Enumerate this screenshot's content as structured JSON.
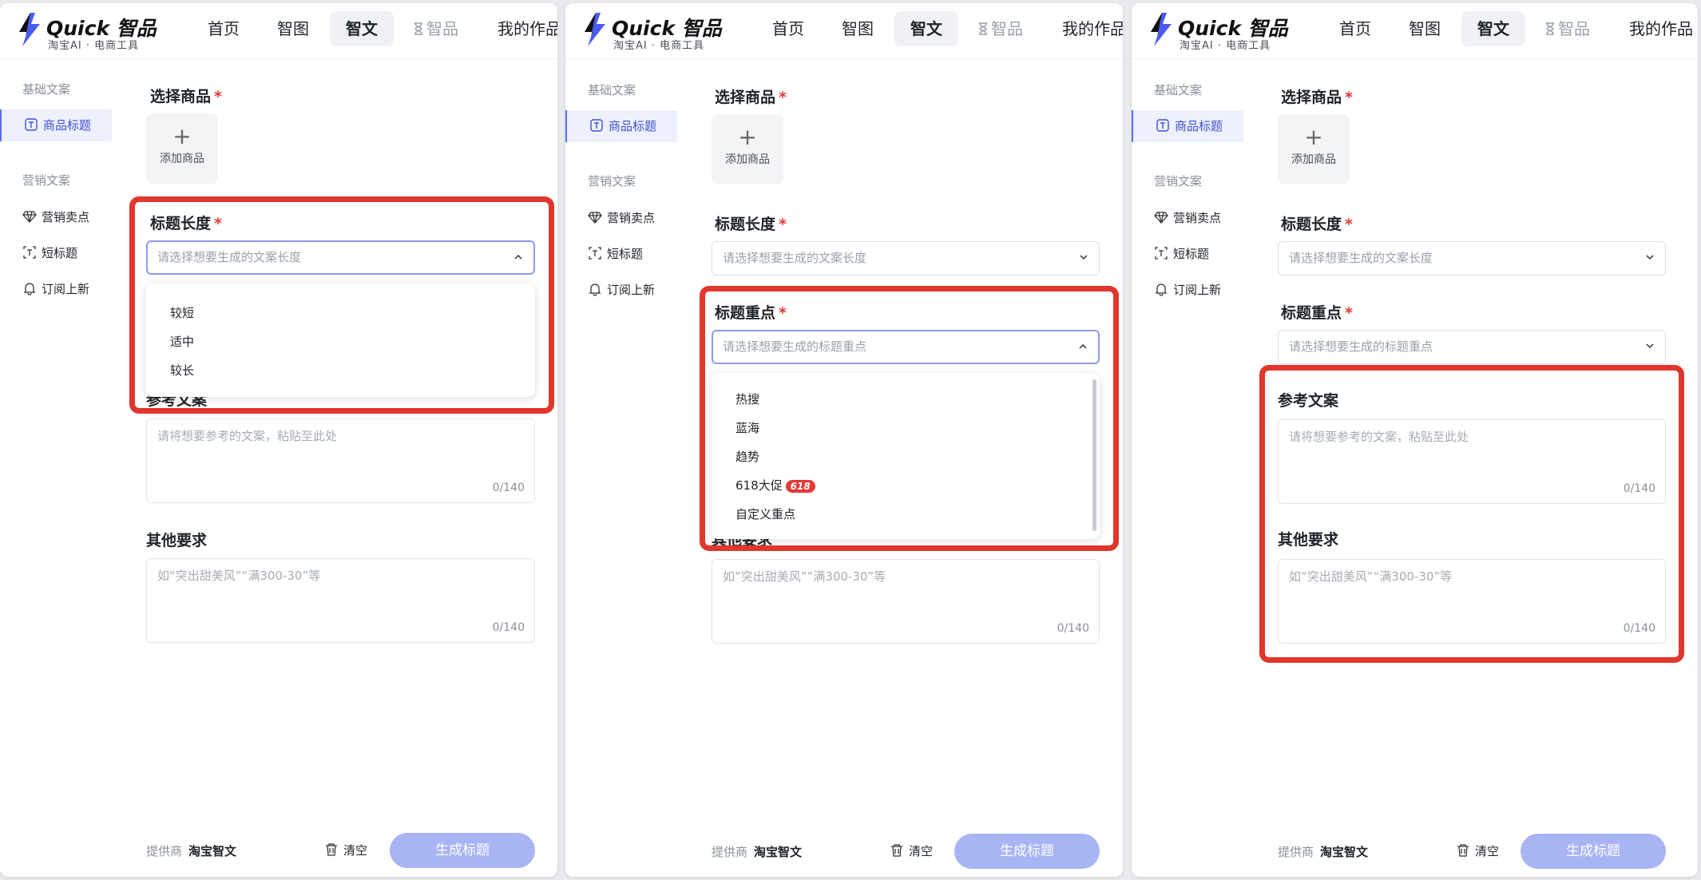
{
  "logo": {
    "brand": "Quick 智品",
    "tagline": "淘宝AI · 电商工具"
  },
  "nav": {
    "home": "首页",
    "zhitu": "智图",
    "zhiwen": "智文",
    "zhipin": "智品",
    "works": "我的作品"
  },
  "sidebar": {
    "group_basic": "基础文案",
    "item_title": "商品标题",
    "group_marketing": "营销文案",
    "item_selling": "营销卖点",
    "item_short": "短标题",
    "item_subscribe": "订阅上新"
  },
  "form": {
    "select_product": "选择商品",
    "add_product": "添加商品",
    "title_length": "标题长度",
    "title_length_placeholder": "请选择想要生成的文案长度",
    "title_focus": "标题重点",
    "title_focus_placeholder": "请选择想要生成的标题重点",
    "reference": "参考文案",
    "reference_placeholder": "请将想要参考的文案，粘贴至此处",
    "other": "其他要求",
    "other_placeholder": "如“突出甜美风”“满300-30”等",
    "counter": "0/140",
    "required_mark": "*"
  },
  "length_options": [
    "较短",
    "适中",
    "较长"
  ],
  "focus_options": [
    "热搜",
    "蓝海",
    "趋势",
    "618大促",
    "自定义重点"
  ],
  "promo_badge": "618",
  "footer": {
    "provider_label": "提供商",
    "provider_name": "淘宝智文",
    "clear": "清空",
    "generate": "生成标题"
  },
  "colors": {
    "accent": "#5b6cf0",
    "highlight": "#e0362c",
    "button": "#a9b4f5"
  }
}
